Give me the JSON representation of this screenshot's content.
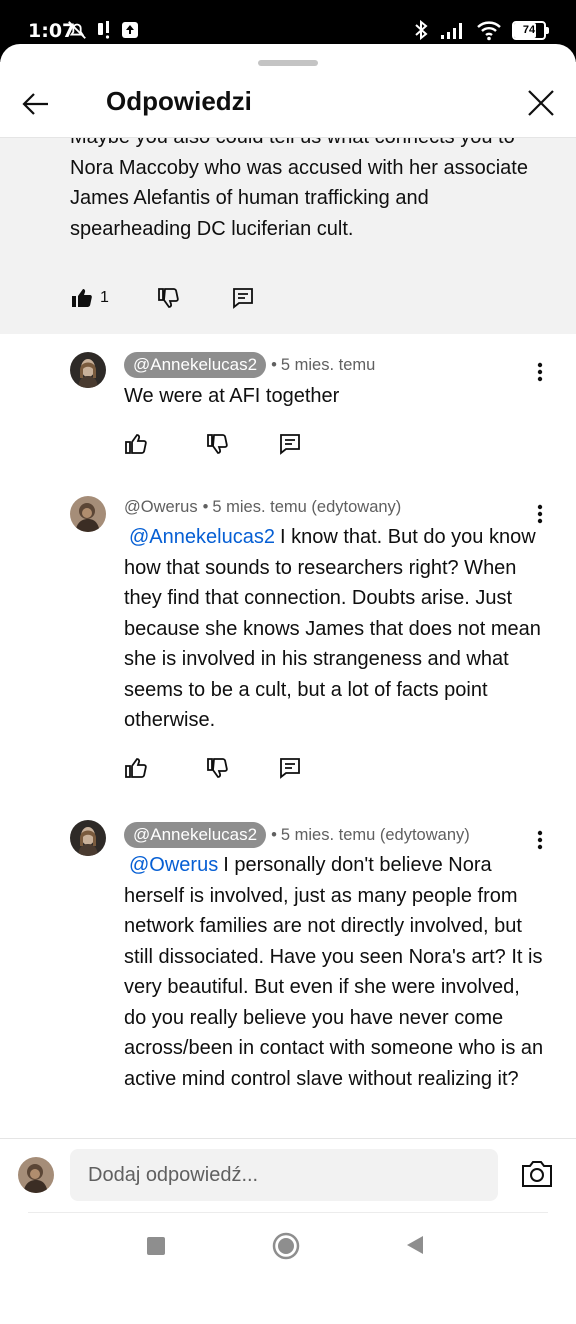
{
  "status_bar": {
    "time": "1:07",
    "battery": "74",
    "battery_fraction": 0.74
  },
  "header": {
    "title": "Odpowiedzi",
    "back_icon": "arrow-left-icon",
    "close_icon": "close-icon"
  },
  "parent_comment": {
    "text": "Maybe you also could tell us what connects you to Nora Maccoby who was accused with her associate James Alefantis of human trafficking and spearheading DC luciferian cult.",
    "like_count": "1"
  },
  "replies": [
    {
      "author": "@Annekelucas2",
      "author_highlighted": true,
      "time": "5 mies. temu",
      "mention": "",
      "text": "We were at AFI together"
    },
    {
      "author": "@Owerus",
      "author_highlighted": false,
      "time": "5 mies. temu (edytowany)",
      "mention": "@Annekelucas2",
      "text": "I know that. But do you know how that sounds to researchers right? When they find that connection. Doubts arise. Just because she knows James that does not mean she is involved in his strangeness and what seems to be a cult, but a lot of facts point otherwise."
    },
    {
      "author": "@Annekelucas2",
      "author_highlighted": true,
      "time": "5 mies. temu (edytowany)",
      "mention": "@Owerus",
      "text": "I personally don't believe Nora herself is involved, just as many people from network families are not directly involved, but still dissociated. Have you seen Nora's art? It is very beautiful. But even if she were involved, do you really believe you have never come across/been in contact with someone who is an active mind control slave without realizing it?"
    }
  ],
  "meta_separator": "•",
  "composer": {
    "placeholder": "Dodaj odpowiedź..."
  },
  "colors": {
    "mention": "#065fd4",
    "chip": "#8e8e8e",
    "parent_bg": "#f2f2f2"
  }
}
